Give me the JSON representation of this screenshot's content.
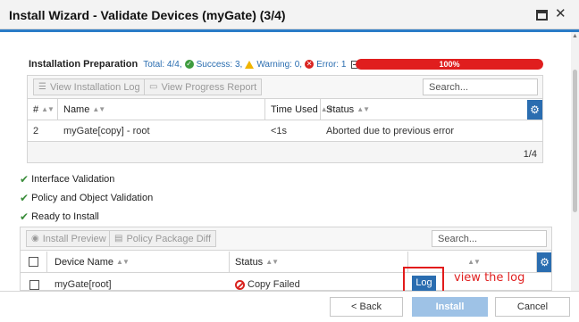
{
  "window": {
    "title": "Install Wizard - Validate Devices (myGate) (3/4)"
  },
  "prep": {
    "title": "Installation Preparation",
    "total": "Total: 4/4,",
    "success": "Success: 3,",
    "warning": "Warning: 0,",
    "error": "Error: 1"
  },
  "progress": {
    "value": 100,
    "label": "100%",
    "color": "#e01e1e"
  },
  "table1": {
    "buttons": {
      "view_log": "View Installation Log",
      "view_report": "View Progress Report"
    },
    "search_placeholder": "Search...",
    "headers": [
      "#",
      "Name",
      "Time Used",
      "Status"
    ],
    "rows": [
      {
        "num": "2",
        "name": "myGate[copy] - root",
        "time": "<1s",
        "status": "Aborted due to previous error"
      }
    ],
    "pager": "1/4"
  },
  "checks": [
    "Interface Validation",
    "Policy and Object Validation",
    "Ready to Install"
  ],
  "table2": {
    "buttons": {
      "install_preview": "Install Preview",
      "policy_diff": "Policy Package Diff"
    },
    "search_placeholder": "Search...",
    "headers": [
      "Device Name",
      "Status"
    ],
    "rows": [
      {
        "device": "myGate[root]",
        "status": "Copy Failed",
        "action": "Log"
      }
    ]
  },
  "annotation": "view the log",
  "footer": {
    "back": "< Back",
    "install": "Install",
    "cancel": "Cancel"
  },
  "colors": {
    "accent": "#2a6db0",
    "error": "#d9231f",
    "success": "#3d9b3d",
    "warning": "#f0b400"
  }
}
